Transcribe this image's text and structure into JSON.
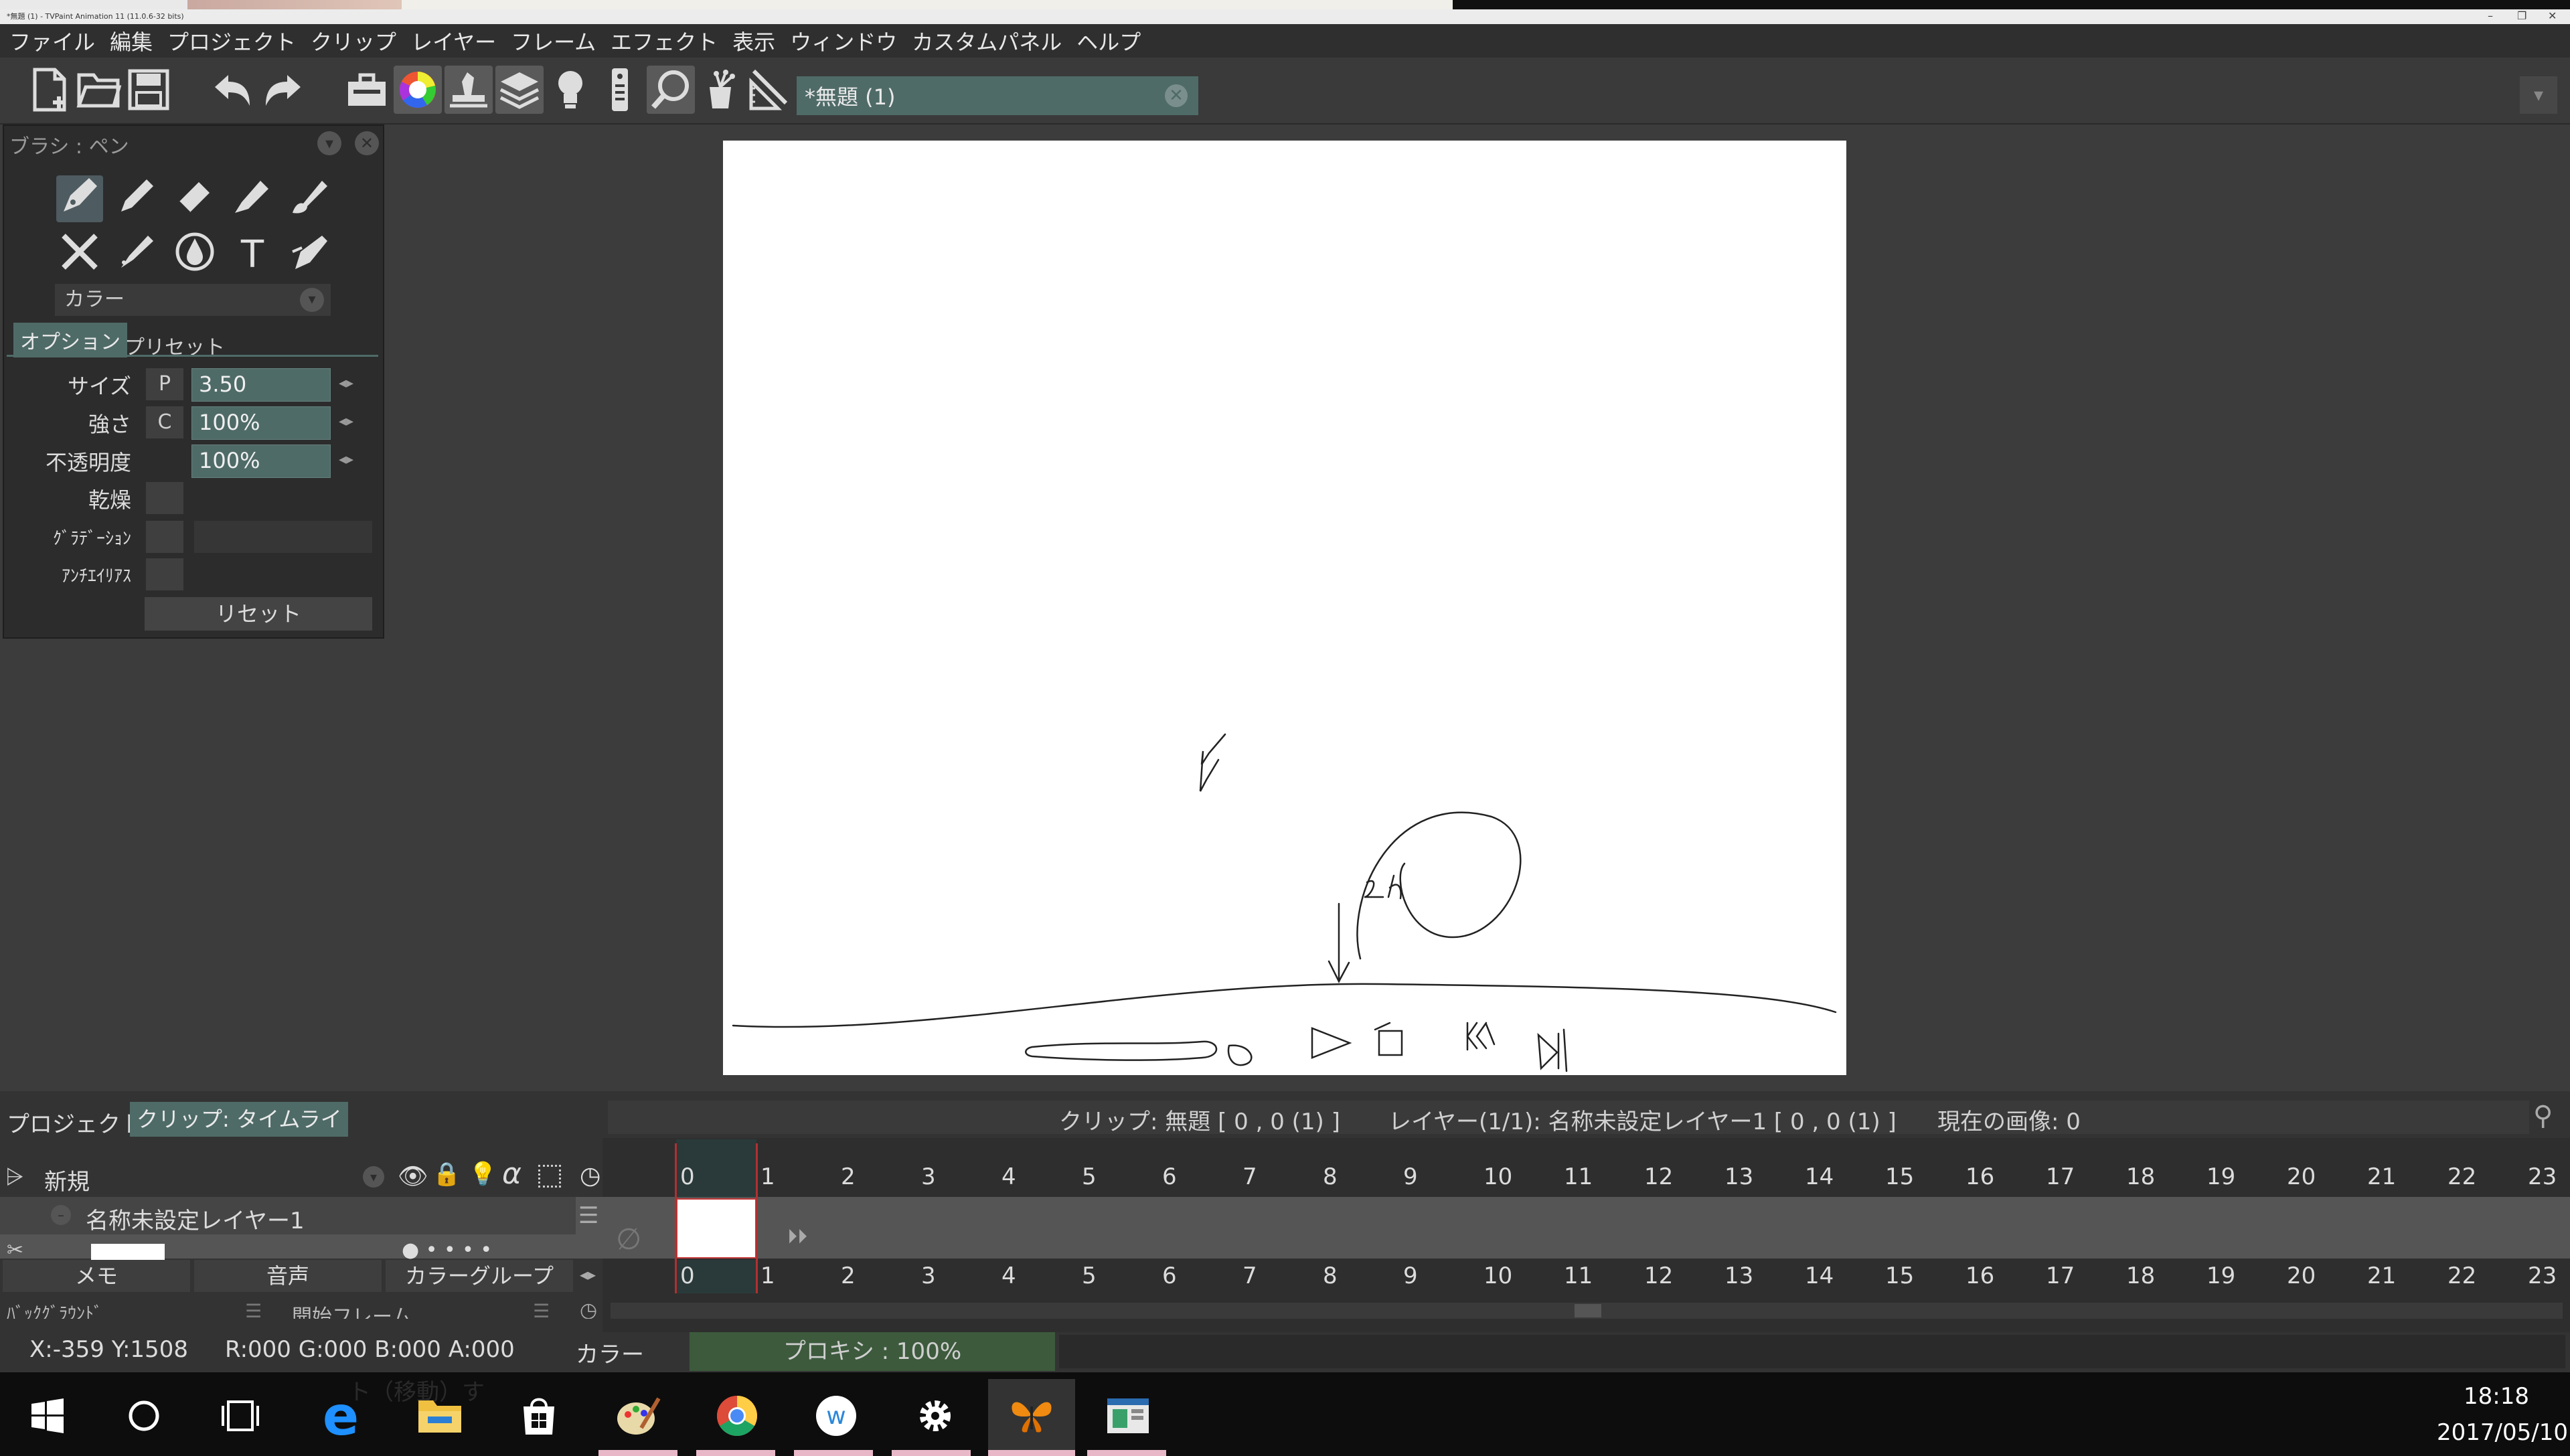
{
  "titlebar": {
    "title": "*無題 (1) - TVPaint Animation 11 (11.0.6-32 bits)",
    "min": "–",
    "restore": "❐",
    "close": "✕"
  },
  "menu": [
    "ファイル",
    "編集",
    "プロジェクト",
    "クリップ",
    "レイヤー",
    "フレーム",
    "エフェクト",
    "表示",
    "ウィンドウ",
    "カスタムパネル",
    "ヘルプ"
  ],
  "toolbar": {
    "doc_tab": "*無題 (1)",
    "icons": [
      "new-file-icon",
      "open-folder-icon",
      "save-icon",
      "undo-icon",
      "redo-icon",
      "toolbox-icon",
      "color-wheel-icon",
      "stamp-icon",
      "layers-icon",
      "lightbulb-icon",
      "remote-icon",
      "magnifier-icon",
      "magic-hat-icon",
      "ruler-icon"
    ]
  },
  "brush_panel": {
    "title": "ブラシ : ペン",
    "color_label": "カラー",
    "tabs": [
      "オプション",
      "プリセット"
    ],
    "rows": [
      {
        "label": "サイズ",
        "prefix": "P",
        "value": "3.50"
      },
      {
        "label": "強さ",
        "prefix": "C",
        "value": "100%"
      },
      {
        "label": "不透明度",
        "prefix": "",
        "value": "100%"
      }
    ],
    "check_rows": [
      "乾燥",
      "ｸﾞﾗﾃﾞｰｼｮﾝ",
      "ｱﾝﾁｴｲﾘｱｽ"
    ],
    "reset": "リセット",
    "text_tool": "T"
  },
  "canvas": {
    "sketch_text": "2h"
  },
  "clip_bar": {
    "tab_project": "プロジェクト",
    "tab_clip": "クリップ:  タイムライン",
    "clip_info": "クリップ: 無題 [ 0 , 0  (1) ]",
    "layer_info": "レイヤー(1/1): 名称未設定レイヤー1 [ 0 , 0  (1) ]",
    "current_image": "現在の画像: 0"
  },
  "timeline": {
    "new_label": "新規",
    "alpha": "α",
    "layer_name": "名称未設定レイヤー1",
    "frames": [
      "0",
      "1",
      "2",
      "3",
      "4",
      "5",
      "6",
      "7",
      "8",
      "9",
      "10",
      "11",
      "12",
      "13",
      "14",
      "15",
      "16",
      "17",
      "18",
      "19",
      "20",
      "21",
      "22",
      "23"
    ],
    "buttons": [
      "メモ",
      "音声",
      "カラーグループ"
    ],
    "background_label": "ﾊﾞｯｸｸﾞﾗｳﾝﾄﾞ",
    "start_frame_label": "開始フレーム"
  },
  "status": {
    "coords": "X:-359  Y:1508",
    "rgba": "R:000 G:000 B:000 A:000",
    "color": "カラー",
    "proxy": "プロキシ : 100%"
  },
  "taskbar": {
    "time": "18:18",
    "date": "2017/05/10",
    "ghost_text": "ト（移動）す"
  }
}
